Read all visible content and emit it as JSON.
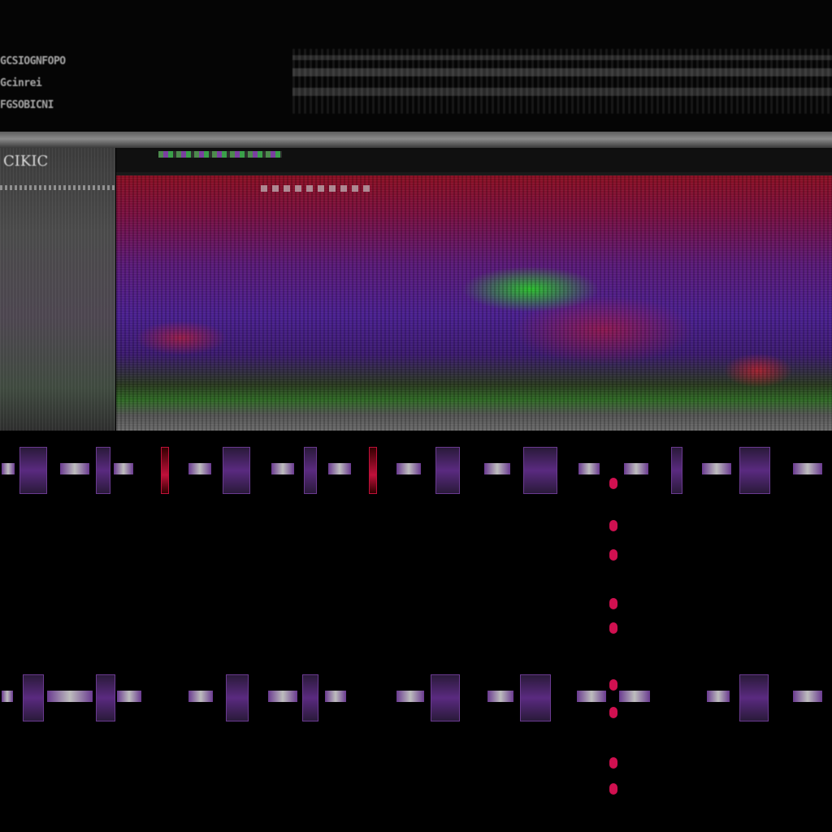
{
  "header": {
    "title_lines": [
      "GCSIOGNFOPO",
      "Gcinrei",
      "FGSOBICNI"
    ]
  },
  "sidebar": {
    "title": "CIKIC"
  },
  "viewport": {
    "toolbar_icon": "tools-strip-icon"
  },
  "colors": {
    "accent_purple": "#6a3a90",
    "accent_red": "#d01050",
    "accent_green": "#3aa04a"
  },
  "timeline": {
    "tracks": [
      {
        "name": "track-1",
        "clips": 22
      },
      {
        "name": "track-2",
        "clips": 20
      }
    ]
  }
}
